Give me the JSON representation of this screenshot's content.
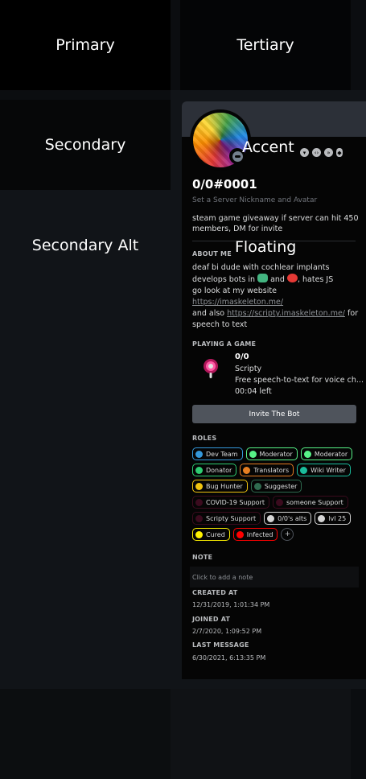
{
  "swatches": {
    "primary": "Primary",
    "tertiary": "Tertiary",
    "secondary": "Secondary",
    "secondary_alt": "Secondary Alt",
    "accent": "Accent",
    "floating": "Floating"
  },
  "colors": {
    "primary": "#000000",
    "tertiary": "#040506",
    "secondary": "#060708",
    "secondary_alt": "#111418",
    "accent": "#2c3038",
    "floating": "#050505",
    "link": "#8e9297"
  },
  "profile": {
    "username": "0/0#0001",
    "nickname_hint": "Set a Server Nickname and Avatar",
    "custom_status": "steam game giveaway if server can hit 450 members, DM for invite",
    "status": "idle/offline",
    "badges": [
      "hypesquad-icon",
      "developer-icon",
      "nitro-boost-icon",
      "boost-gem-icon"
    ]
  },
  "about": {
    "title": "About Me",
    "line1": "deaf bi dude with cochlear implants",
    "line2_pre": "develops bots in",
    "line2_mid": "and",
    "line2_post": ", hates JS",
    "line3": "go look at my website",
    "link1": "https://imaskeleton.me/",
    "line5_pre": "and also",
    "link2": "https://scripty.imaskeleton.me/",
    "line5_post": "for",
    "line6": "speech to text"
  },
  "game": {
    "title": "Playing a Game",
    "name": "0/0",
    "app": "Scripty",
    "details": "Free speech-to-text for voice ch...",
    "elapsed": "00:04 left",
    "invite_label": "Invite The Bot"
  },
  "roles": {
    "title": "Roles",
    "items": [
      {
        "name": "Dev Team",
        "color": "#3498db"
      },
      {
        "name": "Moderator",
        "color": "#57f287"
      },
      {
        "name": "Moderator",
        "color": "#57f287"
      },
      {
        "name": "Donator",
        "color": "#2ecc71"
      },
      {
        "name": "Translators",
        "color": "#e67e22"
      },
      {
        "name": "Wiki Writer",
        "color": "#1abc9c"
      },
      {
        "name": "Bug Hunter",
        "color": "#f1c40f"
      },
      {
        "name": "Suggester",
        "color": "#2f6b4f"
      },
      {
        "name": "COVID-19 Support",
        "color": "#3b0b1e"
      },
      {
        "name": "someone Support",
        "color": "#3b0b1e"
      },
      {
        "name": "Scripty Support",
        "color": "#3b0b1e"
      },
      {
        "name": "0/0's alts",
        "color": "#d5d5d5"
      },
      {
        "name": "lvl 25",
        "color": "#d5d5d5"
      },
      {
        "name": "Cured",
        "color": "#fff200"
      },
      {
        "name": "Infected",
        "color": "#ff0000"
      }
    ]
  },
  "note": {
    "title": "Note",
    "placeholder": "Click to add a note"
  },
  "dates": {
    "created_label": "Created At",
    "created_value": "12/31/2019, 1:01:34 PM",
    "joined_label": "Joined At",
    "joined_value": "2/7/2020, 1:09:52 PM",
    "last_message_label": "Last Message",
    "last_message_value": "6/30/2021, 6:13:35 PM"
  }
}
